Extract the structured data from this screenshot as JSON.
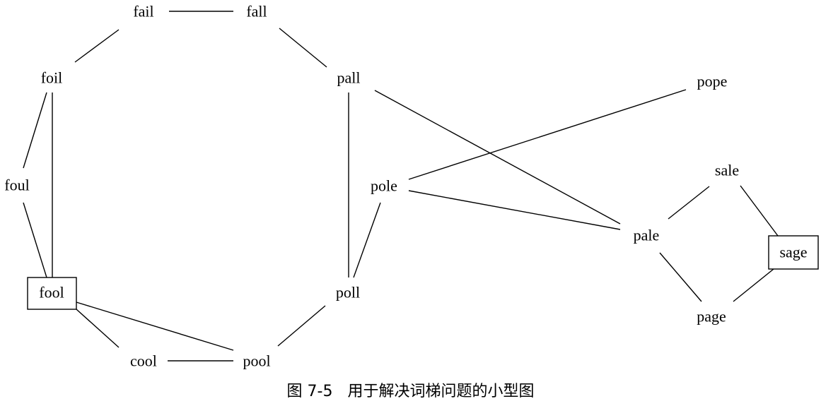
{
  "diagram": {
    "nodes": [
      {
        "id": "fail",
        "label": "fail",
        "boxed": false
      },
      {
        "id": "fall",
        "label": "fall",
        "boxed": false
      },
      {
        "id": "foil",
        "label": "foil",
        "boxed": false
      },
      {
        "id": "pall",
        "label": "pall",
        "boxed": false
      },
      {
        "id": "pope",
        "label": "pope",
        "boxed": false
      },
      {
        "id": "foul",
        "label": "foul",
        "boxed": false
      },
      {
        "id": "pole",
        "label": "pole",
        "boxed": false
      },
      {
        "id": "sale",
        "label": "sale",
        "boxed": false
      },
      {
        "id": "pale",
        "label": "pale",
        "boxed": false
      },
      {
        "id": "sage",
        "label": "sage",
        "boxed": true
      },
      {
        "id": "fool",
        "label": "fool",
        "boxed": true
      },
      {
        "id": "poll",
        "label": "poll",
        "boxed": false
      },
      {
        "id": "page",
        "label": "page",
        "boxed": false
      },
      {
        "id": "cool",
        "label": "cool",
        "boxed": false
      },
      {
        "id": "pool",
        "label": "pool",
        "boxed": false
      }
    ],
    "edges": [
      [
        "fail",
        "fall"
      ],
      [
        "fail",
        "foil"
      ],
      [
        "fall",
        "pall"
      ],
      [
        "foil",
        "foul"
      ],
      [
        "foil",
        "fool"
      ],
      [
        "foul",
        "fool"
      ],
      [
        "fool",
        "cool"
      ],
      [
        "fool",
        "pool"
      ],
      [
        "cool",
        "pool"
      ],
      [
        "pool",
        "poll"
      ],
      [
        "poll",
        "pall"
      ],
      [
        "poll",
        "pole"
      ],
      [
        "pall",
        "pale"
      ],
      [
        "pole",
        "pope"
      ],
      [
        "pole",
        "pale"
      ],
      [
        "pale",
        "sale"
      ],
      [
        "pale",
        "page"
      ],
      [
        "sale",
        "sage"
      ],
      [
        "page",
        "sage"
      ]
    ]
  },
  "caption": "图 7-5   用于解决词梯问题的小型图"
}
